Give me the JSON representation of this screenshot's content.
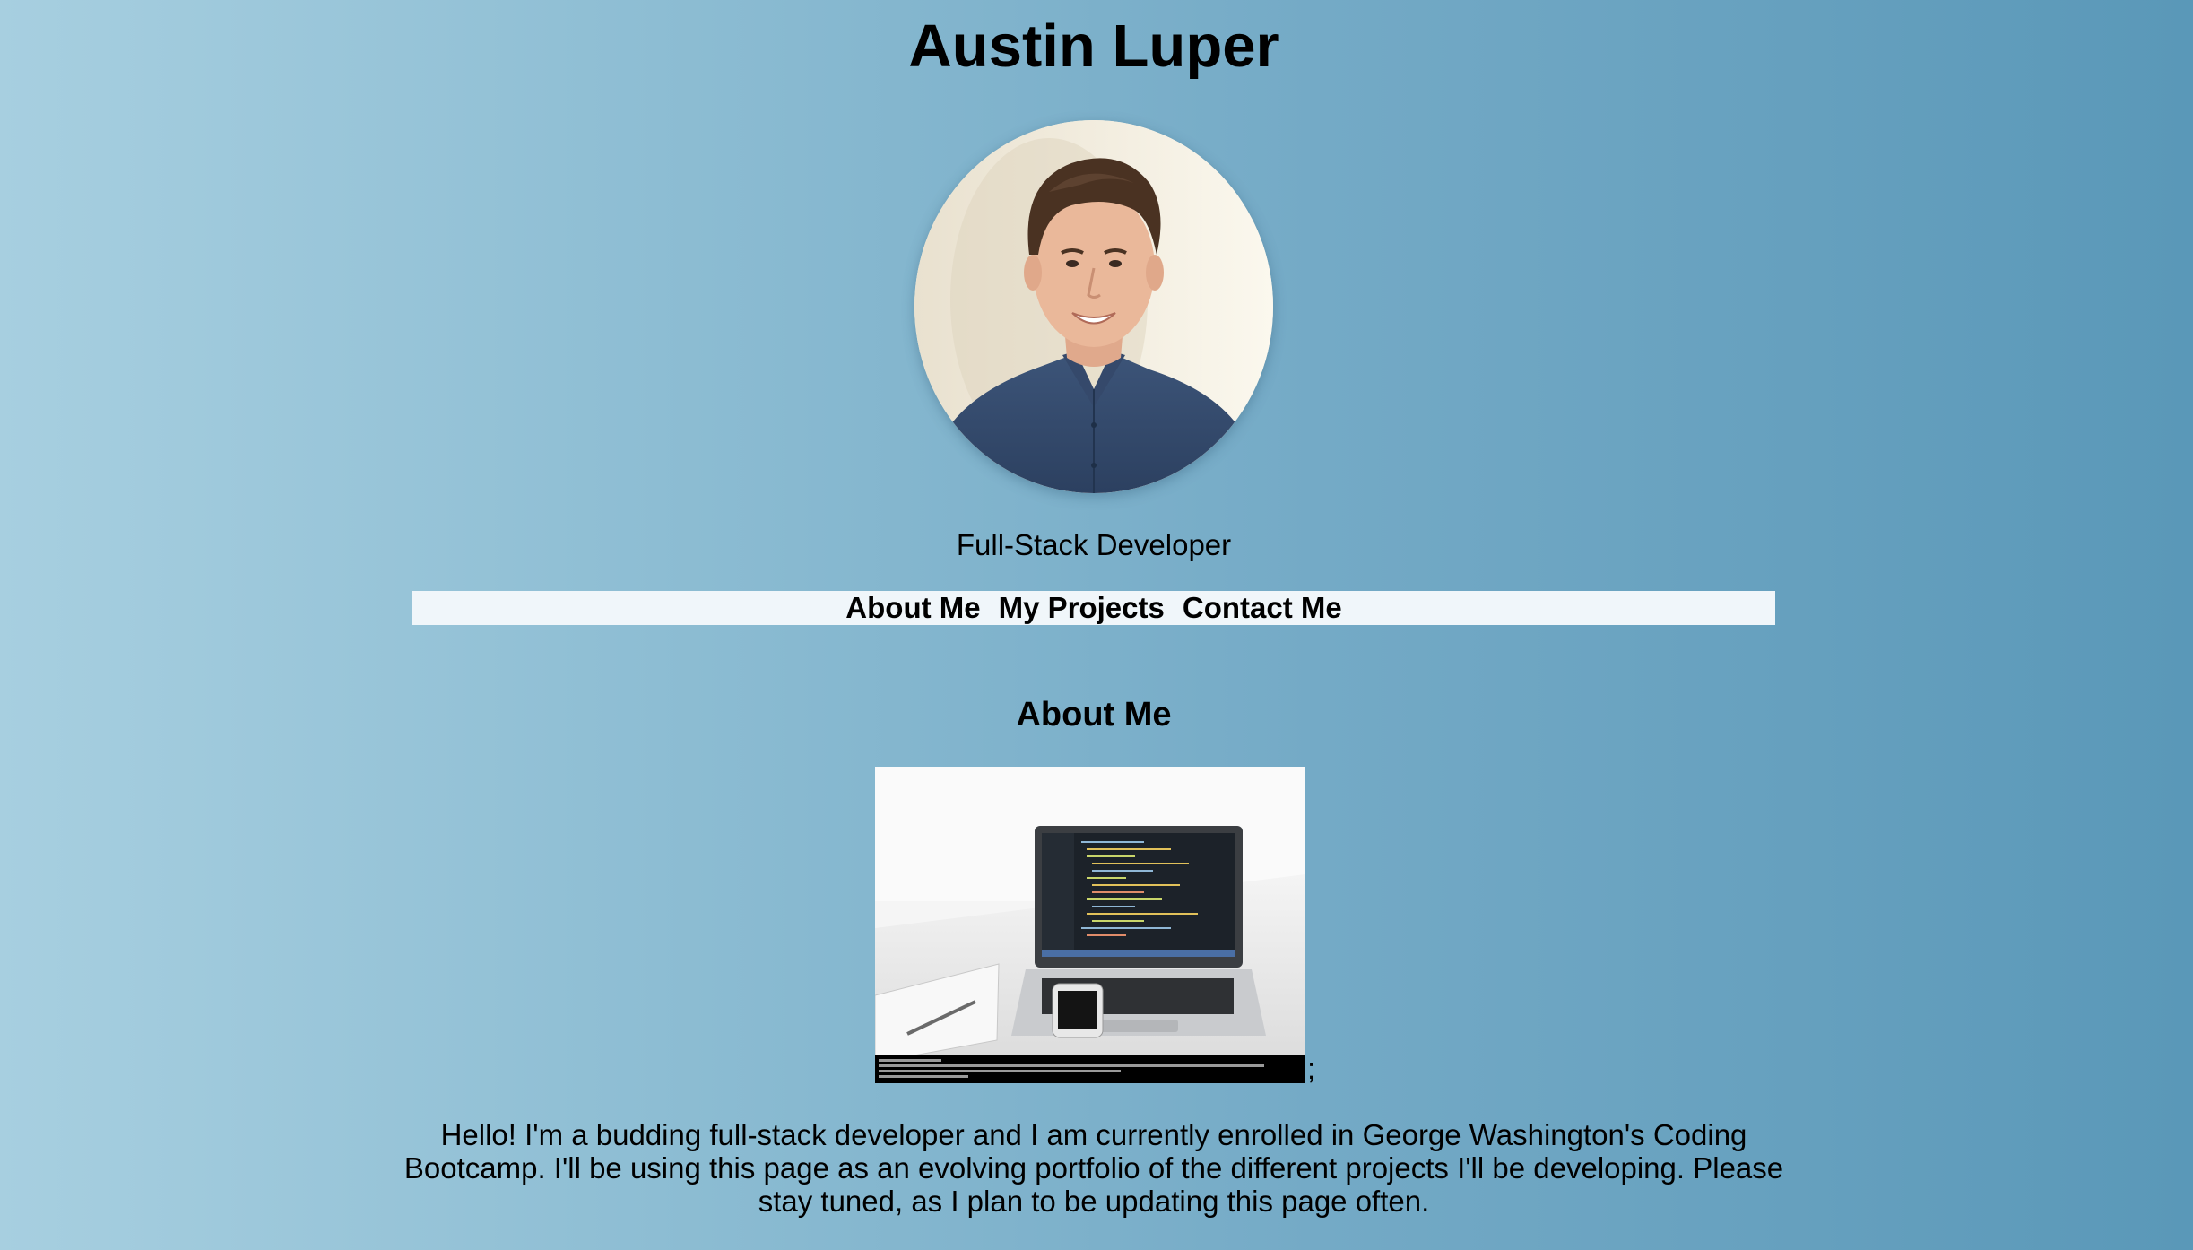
{
  "header": {
    "name": "Austin Luper",
    "role": "Full-Stack Developer"
  },
  "nav": {
    "items": [
      {
        "label": "About Me"
      },
      {
        "label": "My Projects"
      },
      {
        "label": "Contact Me"
      }
    ]
  },
  "about": {
    "title": "About Me",
    "trailing_text": ";",
    "bio": "Hello! I'm a budding full-stack developer and I am currently enrolled in George Washington's Coding Bootcamp. I'll be using this page as an evolving portfolio of the different projects I'll be developing. Please stay tuned, as I plan to be updating this page often."
  },
  "colors": {
    "background_left": "#a7cfe0",
    "background_right": "#5a98b8",
    "nav_background": "#f0f6fa",
    "text": "#000000"
  }
}
